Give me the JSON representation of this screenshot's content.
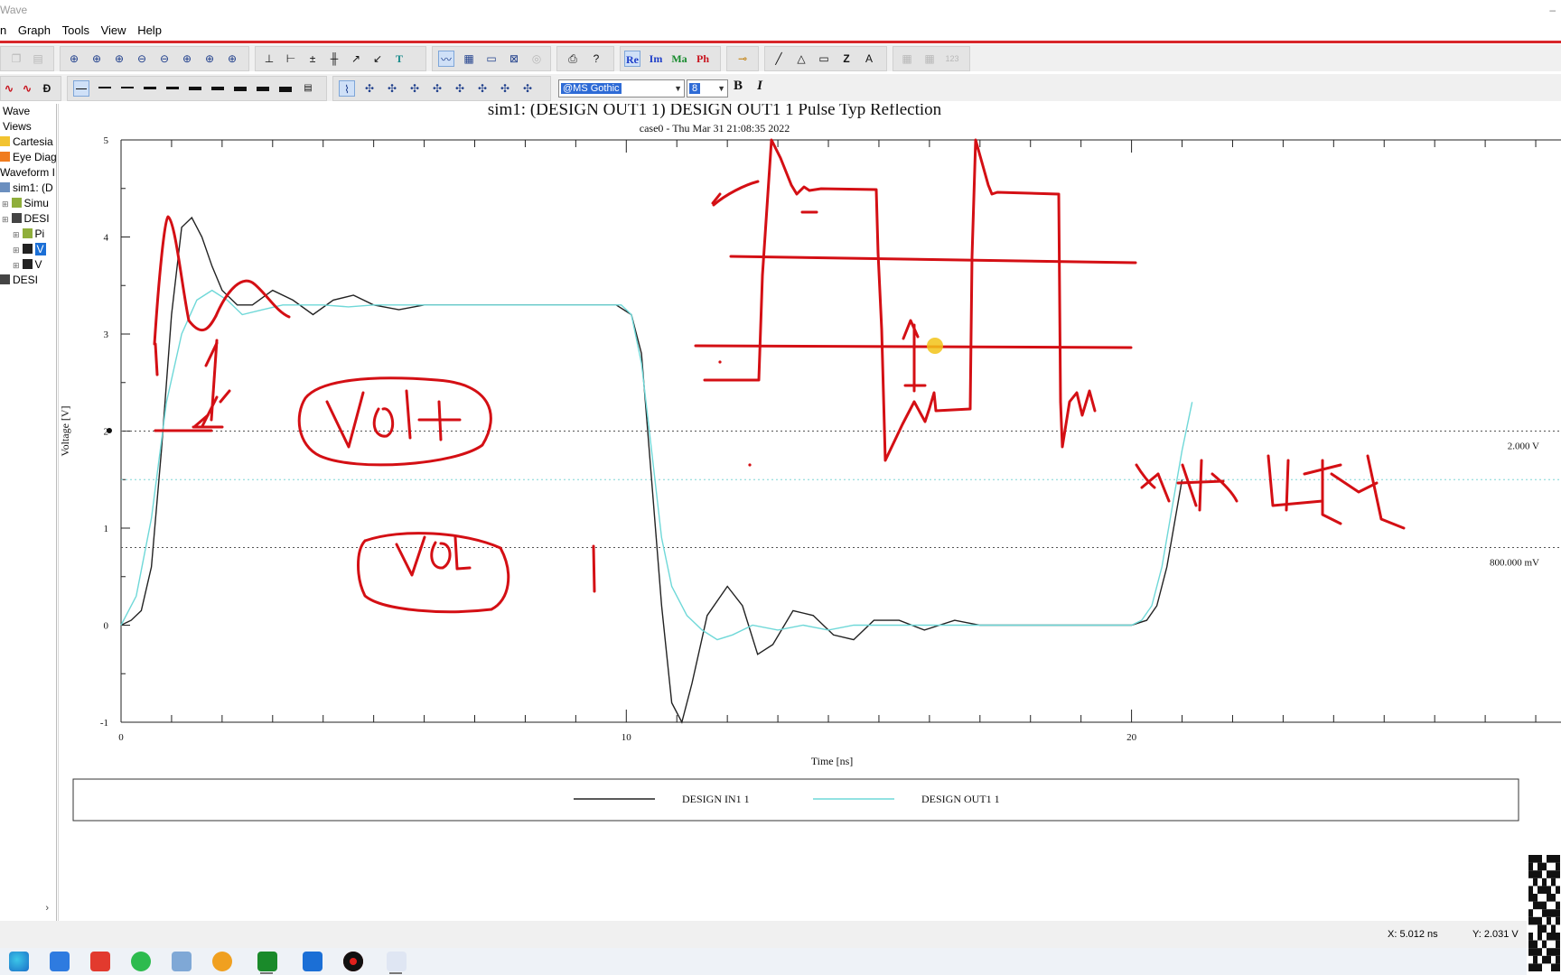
{
  "app": {
    "title": "Wave",
    "minimize": "–"
  },
  "menu": [
    "Graph",
    "Tools",
    "View",
    "Help"
  ],
  "menu_prefix": "n",
  "toolbar": {
    "complex_buttons": [
      "Re",
      "Im",
      "Ma",
      "Ph"
    ],
    "font_name": "@MS Gothic",
    "font_size": "8",
    "bold": "B",
    "italic": "I",
    "text_tool": "T",
    "draw_tools": [
      "Z",
      "A"
    ],
    "pwr_label": "123"
  },
  "tree": {
    "items": [
      {
        "label": "Wave",
        "icon": "wave-icon",
        "indent": 0
      },
      {
        "label": "Views",
        "icon": "folder-icon",
        "indent": 0
      },
      {
        "label": "Cartesia",
        "icon": "cartesian-icon",
        "indent": 0
      },
      {
        "label": "Eye Diag",
        "icon": "eye-diagram-icon",
        "indent": 0
      },
      {
        "label": "Waveform I",
        "icon": "",
        "indent": 0
      },
      {
        "label": "sim1: (D",
        "icon": "sim-icon",
        "indent": 0
      },
      {
        "label": "Simu",
        "icon": "simulation-icon",
        "indent": 1
      },
      {
        "label": "DESI",
        "icon": "waveform-icon",
        "indent": 1
      },
      {
        "label": "Pi",
        "icon": "pin-icon",
        "indent": 2
      },
      {
        "label": "V",
        "icon": "probe-icon",
        "indent": 2,
        "selected": true
      },
      {
        "label": "V",
        "icon": "probe-icon",
        "indent": 2
      },
      {
        "label": "DESI",
        "icon": "waveform-icon",
        "indent": 0
      }
    ]
  },
  "graph": {
    "title": "sim1: (DESIGN OUT1 1) DESIGN OUT1 1 Pulse Typ Reflection",
    "subtitle": "case0 - Thu Mar 31 21:08:35 2022",
    "ref_line_labels": [
      "2.000 V",
      "800.000 mV"
    ]
  },
  "chart_data": {
    "type": "line",
    "title": "sim1: (DESIGN OUT1 1) DESIGN OUT1 1 Pulse Typ Reflection",
    "subtitle": "case0 - Thu Mar 31 21:08:35 2022",
    "xlabel": "Time [ns]",
    "ylabel": "Voltage [V]",
    "xlim": [
      0,
      28.5
    ],
    "ylim": [
      -1,
      5
    ],
    "xticks": [
      0,
      10,
      20
    ],
    "yticks": [
      -1,
      0,
      1,
      2,
      3,
      4,
      5
    ],
    "ref_lines": [
      {
        "y": 2.0,
        "label": "2.000 V",
        "color": "#555555",
        "style": "dotted"
      },
      {
        "y": 1.5,
        "label": "",
        "color": "#7fd6d6",
        "style": "dotted"
      },
      {
        "y": 0.8,
        "label": "800.000 mV",
        "color": "#555555",
        "style": "dotted"
      }
    ],
    "legend_position": "bottom",
    "series": [
      {
        "name": "DESIGN IN1 1",
        "color": "#222222",
        "x": [
          0,
          0.2,
          0.4,
          0.6,
          0.8,
          1.0,
          1.2,
          1.4,
          1.6,
          1.8,
          2.0,
          2.3,
          2.6,
          3.0,
          3.4,
          3.8,
          4.2,
          4.6,
          5.0,
          5.5,
          6.0,
          6.5,
          7.0,
          8.0,
          9.0,
          9.8,
          10.1,
          10.3,
          10.5,
          10.7,
          10.9,
          11.1,
          11.3,
          11.6,
          12.0,
          12.3,
          12.6,
          12.9,
          13.3,
          13.7,
          14.1,
          14.5,
          14.9,
          15.4,
          15.9,
          16.5,
          17.0,
          17.5,
          18.0,
          18.5,
          19.0,
          19.5,
          20.0,
          20.3,
          20.5,
          20.7,
          20.9,
          21.0
        ],
        "y": [
          0,
          0.05,
          0.15,
          0.6,
          1.8,
          3.2,
          4.1,
          4.2,
          4.0,
          3.7,
          3.45,
          3.3,
          3.3,
          3.45,
          3.35,
          3.2,
          3.35,
          3.4,
          3.3,
          3.25,
          3.3,
          3.3,
          3.3,
          3.3,
          3.3,
          3.3,
          3.2,
          2.8,
          1.5,
          0.2,
          -0.8,
          -1.0,
          -0.6,
          0.1,
          0.4,
          0.2,
          -0.3,
          -0.2,
          0.15,
          0.1,
          -0.1,
          -0.15,
          0.05,
          0.05,
          -0.05,
          0.05,
          0.0,
          0.0,
          0.0,
          0.0,
          0.0,
          0.0,
          0.0,
          0.05,
          0.2,
          0.6,
          1.2,
          1.5
        ]
      },
      {
        "name": "DESIGN OUT1 1",
        "color": "#6fd8d8",
        "x": [
          0,
          0.3,
          0.6,
          0.9,
          1.2,
          1.5,
          1.8,
          2.1,
          2.4,
          2.8,
          3.2,
          3.6,
          4.0,
          4.5,
          5.0,
          6.0,
          7.0,
          8.0,
          9.0,
          9.9,
          10.1,
          10.3,
          10.5,
          10.7,
          10.9,
          11.2,
          11.5,
          11.8,
          12.1,
          12.5,
          13.0,
          13.5,
          14.0,
          14.5,
          15.0,
          16.0,
          17.0,
          18.0,
          19.0,
          20.0,
          20.2,
          20.4,
          20.6,
          20.8,
          21.0,
          21.2
        ],
        "y": [
          0,
          0.3,
          1.1,
          2.3,
          3.0,
          3.35,
          3.45,
          3.35,
          3.2,
          3.25,
          3.3,
          3.3,
          3.3,
          3.28,
          3.3,
          3.3,
          3.3,
          3.3,
          3.3,
          3.3,
          3.2,
          2.7,
          1.8,
          0.9,
          0.4,
          0.1,
          -0.05,
          -0.15,
          -0.1,
          0.0,
          -0.05,
          0.0,
          -0.05,
          0.0,
          0.0,
          0.0,
          0.0,
          0.0,
          0.0,
          0.0,
          0.05,
          0.2,
          0.6,
          1.2,
          1.8,
          2.3
        ]
      }
    ]
  },
  "status": {
    "x_readout": "X:  5.012 ns",
    "y_readout": "Y:  2.031 V"
  },
  "colors": {
    "annotation": "#d40f14",
    "accent_red": "#d8262a",
    "series_in": "#222222",
    "series_out": "#6fd8d8"
  }
}
